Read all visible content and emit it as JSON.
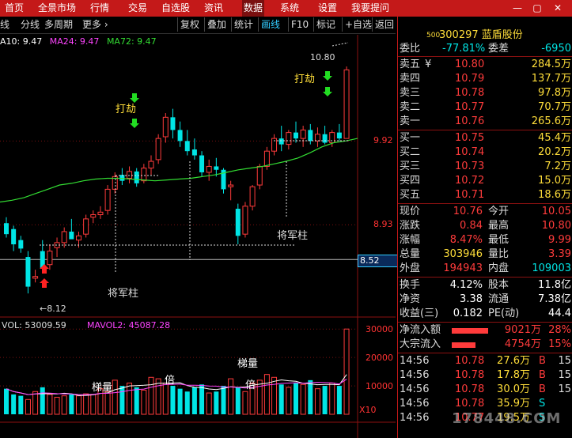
{
  "menu": {
    "items": [
      "首页",
      "全景市场",
      "行情",
      "交易",
      "自选股",
      "资讯",
      "数据",
      "系统",
      "设置",
      "我要提问"
    ],
    "active_index": 6
  },
  "window_controls": [
    "—",
    "▢",
    "✕"
  ],
  "toolbar": {
    "left_items": [
      "线",
      "分线",
      "多周期",
      "更多 ›"
    ],
    "buttons": [
      "复权",
      "叠加",
      "统计",
      "画线",
      "F10",
      "标记",
      "+自选",
      "返回"
    ],
    "selected_button": "画线"
  },
  "ma_line": {
    "ma10": "A10: 9.47",
    "ma24": "MA24: 9.47",
    "ma72": "MA72: 9.47"
  },
  "chart_data": [
    {
      "type": "candlestick",
      "price_axis_labels": [
        "9.92",
        "8.93",
        "8.52"
      ],
      "last_price_label": "8.52",
      "high_label": "10.80",
      "low_label": "8.12",
      "annotations": [
        "打劫",
        "打劫",
        "将军柱",
        "将军柱"
      ],
      "candles_ohlc": [
        [
          8.95,
          9.02,
          8.78,
          8.82
        ],
        [
          8.88,
          8.92,
          8.62,
          8.7
        ],
        [
          8.75,
          8.8,
          8.6,
          8.65
        ],
        [
          8.55,
          8.62,
          8.12,
          8.2
        ],
        [
          8.3,
          8.4,
          8.25,
          8.32
        ],
        [
          8.62,
          8.75,
          8.38,
          8.42
        ],
        [
          8.46,
          8.7,
          8.4,
          8.62
        ],
        [
          8.66,
          8.78,
          8.55,
          8.72
        ],
        [
          8.72,
          8.9,
          8.66,
          8.85
        ],
        [
          8.85,
          9.0,
          8.78,
          8.76
        ],
        [
          8.75,
          8.85,
          8.66,
          8.8
        ],
        [
          8.82,
          9.05,
          8.78,
          9.0
        ],
        [
          9.02,
          9.1,
          8.95,
          9.05
        ],
        [
          9.05,
          9.15,
          9.0,
          9.08
        ],
        [
          9.1,
          9.4,
          9.05,
          9.35
        ],
        [
          9.35,
          9.55,
          9.3,
          9.5
        ],
        [
          9.52,
          9.6,
          9.4,
          9.45
        ],
        [
          9.48,
          9.62,
          9.42,
          9.56
        ],
        [
          9.56,
          9.6,
          9.38,
          9.42
        ],
        [
          9.45,
          9.65,
          9.42,
          9.6
        ],
        [
          9.6,
          9.75,
          9.52,
          9.68
        ],
        [
          9.7,
          10.0,
          9.65,
          9.95
        ],
        [
          9.97,
          10.25,
          9.9,
          10.2
        ],
        [
          10.2,
          10.3,
          9.95,
          10.05
        ],
        [
          10.05,
          10.15,
          9.85,
          9.92
        ],
        [
          9.92,
          10.05,
          9.75,
          9.8
        ],
        [
          9.82,
          9.95,
          9.7,
          9.75
        ],
        [
          9.75,
          9.8,
          9.5,
          9.55
        ],
        [
          9.55,
          9.7,
          9.45,
          9.62
        ],
        [
          9.62,
          9.72,
          9.5,
          9.58
        ],
        [
          9.58,
          9.6,
          9.3,
          9.35
        ],
        [
          9.38,
          9.45,
          9.22,
          9.4
        ],
        [
          9.12,
          9.18,
          8.7,
          8.8
        ],
        [
          8.82,
          9.2,
          8.78,
          9.15
        ],
        [
          9.15,
          9.4,
          9.1,
          9.38
        ],
        [
          9.4,
          9.65,
          9.35,
          9.62
        ],
        [
          9.62,
          9.85,
          9.58,
          9.8
        ],
        [
          9.8,
          10.0,
          9.75,
          9.95
        ],
        [
          9.95,
          10.1,
          9.8,
          9.88
        ],
        [
          9.88,
          10.05,
          9.82,
          10.02
        ],
        [
          10.02,
          10.15,
          9.9,
          9.95
        ],
        [
          9.95,
          10.1,
          9.85,
          10.05
        ],
        [
          10.05,
          10.12,
          9.88,
          9.92
        ],
        [
          9.92,
          10.08,
          9.85,
          10.0
        ],
        [
          10.0,
          10.1,
          9.88,
          9.9
        ],
        [
          9.9,
          10.05,
          9.85,
          10.02
        ],
        [
          10.02,
          10.12,
          9.92,
          9.95
        ],
        [
          9.95,
          10.8,
          9.95,
          10.76
        ]
      ],
      "ma_line": [
        9.2,
        9.22,
        9.25,
        9.3,
        9.35,
        9.4,
        9.42,
        9.45,
        9.47,
        9.48,
        9.48,
        9.47,
        9.46,
        9.45,
        9.46,
        9.47,
        9.48,
        9.5,
        9.52,
        9.55,
        9.58,
        9.6,
        9.62,
        9.65,
        9.68,
        9.72,
        9.78,
        9.85,
        9.9,
        9.92,
        9.95
      ]
    },
    {
      "type": "bar",
      "title": "VOL: 53009.59",
      "mavol2": "MAVOL2: 45087.28",
      "axis_labels": [
        "30000",
        "20000",
        "10000"
      ],
      "multiplier_label": "X10",
      "annotations": [
        "梯量",
        "梯量",
        "倍",
        "倍"
      ],
      "ylim": [
        0,
        32000
      ],
      "values": [
        9000,
        7000,
        6500,
        5200,
        8000,
        9500,
        7000,
        6000,
        6500,
        7000,
        6500,
        7200,
        7000,
        9000,
        8000,
        12000,
        10000,
        11000,
        9500,
        8500,
        13000,
        12500,
        11000,
        10000,
        9000,
        8000,
        9500,
        10500,
        7500,
        8000,
        10000,
        12500,
        9500,
        8000,
        11000,
        12000,
        14000,
        13000,
        10500,
        9500,
        11000,
        10500,
        12000,
        9000,
        10000,
        11000,
        10000,
        30000
      ],
      "colors": [
        "c",
        "c",
        "c",
        "r",
        "r",
        "c",
        "r",
        "r",
        "r",
        "c",
        "r",
        "r",
        "r",
        "r",
        "r",
        "r",
        "c",
        "r",
        "c",
        "r",
        "r",
        "r",
        "r",
        "c",
        "c",
        "c",
        "c",
        "c",
        "r",
        "c",
        "c",
        "r",
        "c",
        "r",
        "r",
        "r",
        "r",
        "r",
        "c",
        "r",
        "c",
        "r",
        "c",
        "r",
        "c",
        "r",
        "c",
        "r"
      ]
    }
  ],
  "stock": {
    "code": "300297",
    "name": "蓝盾股份",
    "prefix": "500"
  },
  "quote_header": {
    "label1": "委比",
    "value1": "-77.81%",
    "label2": "委差",
    "value2": "-6950"
  },
  "asks": [
    {
      "label": "卖五",
      "marker": "¥",
      "price": "10.80",
      "vol": "284.5万"
    },
    {
      "label": "卖四",
      "marker": "",
      "price": "10.79",
      "vol": "137.7万"
    },
    {
      "label": "卖三",
      "marker": "",
      "price": "10.78",
      "vol": "97.8万"
    },
    {
      "label": "卖二",
      "marker": "",
      "price": "10.77",
      "vol": "70.7万"
    },
    {
      "label": "卖一",
      "marker": "",
      "price": "10.76",
      "vol": "265.6万"
    }
  ],
  "bids": [
    {
      "label": "买一",
      "price": "10.75",
      "vol": "45.4万"
    },
    {
      "label": "买二",
      "price": "10.74",
      "vol": "20.2万"
    },
    {
      "label": "买三",
      "price": "10.73",
      "vol": "7.2万"
    },
    {
      "label": "买四",
      "price": "10.72",
      "vol": "15.0万"
    },
    {
      "label": "买五",
      "price": "10.71",
      "vol": "18.6万"
    }
  ],
  "stats": [
    {
      "l1": "现价",
      "v1": "10.76",
      "l2": "今开",
      "v2": "10.05",
      "c1": "red",
      "c2": "red"
    },
    {
      "l1": "涨跌",
      "v1": "0.84",
      "l2": "最高",
      "v2": "10.80",
      "c1": "red",
      "c2": "red"
    },
    {
      "l1": "涨幅",
      "v1": "8.47%",
      "l2": "最低",
      "v2": "9.99",
      "c1": "red",
      "c2": "red"
    },
    {
      "l1": "总量",
      "v1": "303946",
      "l2": "量比",
      "v2": "3.39",
      "c1": "yel",
      "c2": "red"
    },
    {
      "l1": "外盘",
      "v1": "194943",
      "l2": "内盘",
      "v2": "109003",
      "c1": "red",
      "c2": "green"
    }
  ],
  "stats2": [
    {
      "l1": "换手",
      "v1": "4.12%",
      "l2": "股本",
      "v2": "11.8亿"
    },
    {
      "l1": "净资",
      "v1": "3.38",
      "l2": "流通",
      "v2": "7.38亿"
    },
    {
      "l1": "收益(三)",
      "v1": "0.182",
      "l2": "PE(动)",
      "v2": "44.4"
    }
  ],
  "flows": [
    {
      "label": "净流入额",
      "value": "9021万",
      "pct": "28%"
    },
    {
      "label": "大宗流入",
      "value": "4754万",
      "pct": "15%"
    }
  ],
  "ticks": [
    {
      "time": "14:56",
      "price": "10.78",
      "vol": "27.6万",
      "side": "B",
      "n": "15"
    },
    {
      "time": "14:56",
      "price": "10.78",
      "vol": "17.8万",
      "side": "B",
      "n": "15"
    },
    {
      "time": "14:56",
      "price": "10.78",
      "vol": "30.0万",
      "side": "B",
      "n": "15"
    },
    {
      "time": "14:56",
      "price": "10.78",
      "vol": "35.9万",
      "side": "S",
      "n": ""
    },
    {
      "time": "14:56",
      "price": "10.77",
      "vol": "19.5万",
      "side": "S",
      "n": ""
    }
  ],
  "watermark": "178448.COM",
  "colors": {
    "menu_bg": "#c41919",
    "up": "#ff3b3b",
    "down": "#00e5e5",
    "ma10": "#ffffff",
    "ma24": "#ff44ff",
    "ma72": "#33dd33",
    "accent": "#ffde3a"
  }
}
